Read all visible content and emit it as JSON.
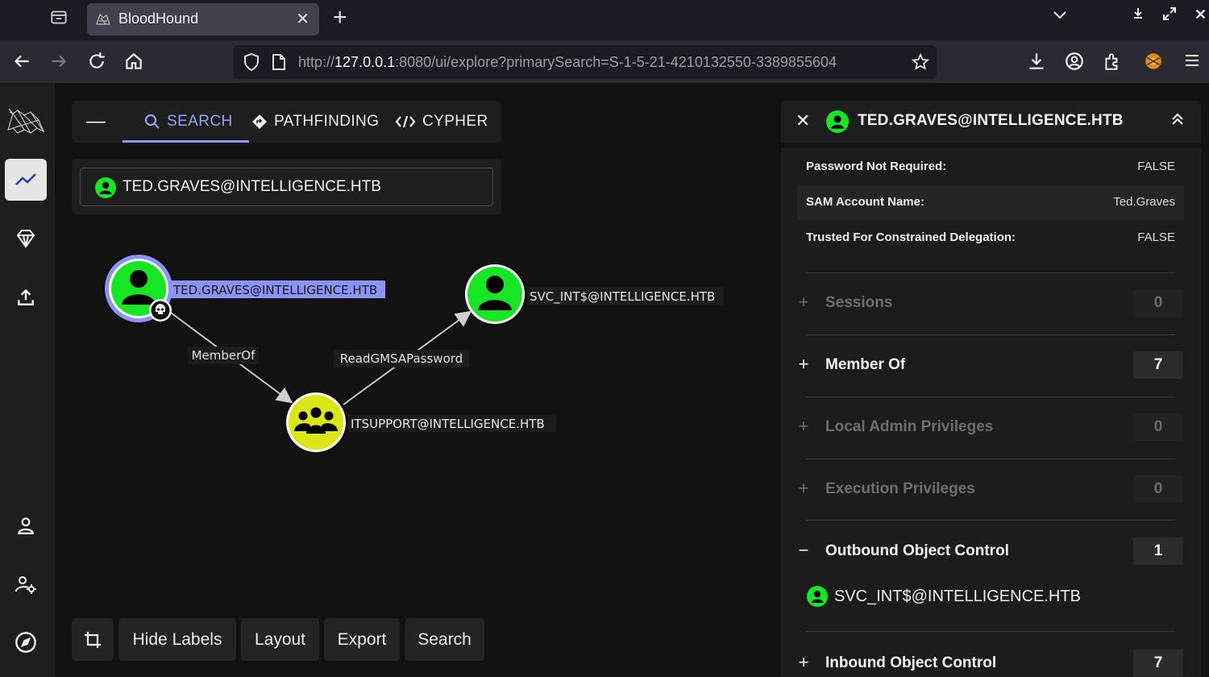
{
  "browser": {
    "tab_title": "BloodHound",
    "url_scheme": "http://",
    "url_host": "127.0.0.1",
    "url_rest": ":8080/ui/explore?primarySearch=S-1-5-21-4210132550-3389855604"
  },
  "search_panel": {
    "tabs": [
      {
        "label": "SEARCH",
        "icon": "search-icon"
      },
      {
        "label": "PATHFINDING",
        "icon": "diamond-arrow-icon"
      },
      {
        "label": "CYPHER",
        "icon": "code-icon"
      }
    ],
    "query_value": "TED.GRAVES@INTELLIGENCE.HTB"
  },
  "graph": {
    "nodes": [
      {
        "id": "ted",
        "label": "TED.GRAVES@INTELLIGENCE.HTB",
        "kind": "user",
        "highlighted": true,
        "owned": true
      },
      {
        "id": "itsupport",
        "label": "ITSUPPORT@INTELLIGENCE.HTB",
        "kind": "group"
      },
      {
        "id": "svc",
        "label": "SVC_INT$@INTELLIGENCE.HTB",
        "kind": "user"
      }
    ],
    "edges": [
      {
        "from": "ted",
        "to": "itsupport",
        "label": "MemberOf"
      },
      {
        "from": "itsupport",
        "to": "svc",
        "label": "ReadGMSAPassword"
      }
    ],
    "colors": {
      "user": "#17e625",
      "group": "#dbe617",
      "selected_ring": "#8c93f2"
    }
  },
  "bottom_buttons": {
    "hide_labels": "Hide Labels",
    "layout": "Layout",
    "export": "Export",
    "search": "Search"
  },
  "entity_panel": {
    "title": "TED.GRAVES@INTELLIGENCE.HTB",
    "properties": [
      {
        "key": "Password Not Required:",
        "value": "FALSE"
      },
      {
        "key": "SAM Account Name:",
        "value": "Ted.Graves"
      },
      {
        "key": "Trusted For Constrained Delegation:",
        "value": "FALSE"
      }
    ],
    "sections": [
      {
        "sign": "+",
        "label": "Sessions",
        "count": "0",
        "enabled": false
      },
      {
        "sign": "+",
        "label": "Member Of",
        "count": "7",
        "enabled": true
      },
      {
        "sign": "+",
        "label": "Local Admin Privileges",
        "count": "0",
        "enabled": false
      },
      {
        "sign": "+",
        "label": "Execution Privileges",
        "count": "0",
        "enabled": false
      },
      {
        "sign": "−",
        "label": "Outbound Object Control",
        "count": "1",
        "enabled": true
      },
      {
        "sign": "+",
        "label": "Inbound Object Control",
        "count": "7",
        "enabled": true
      }
    ],
    "outbound_items": [
      "SVC_INT$@INTELLIGENCE.HTB"
    ]
  }
}
